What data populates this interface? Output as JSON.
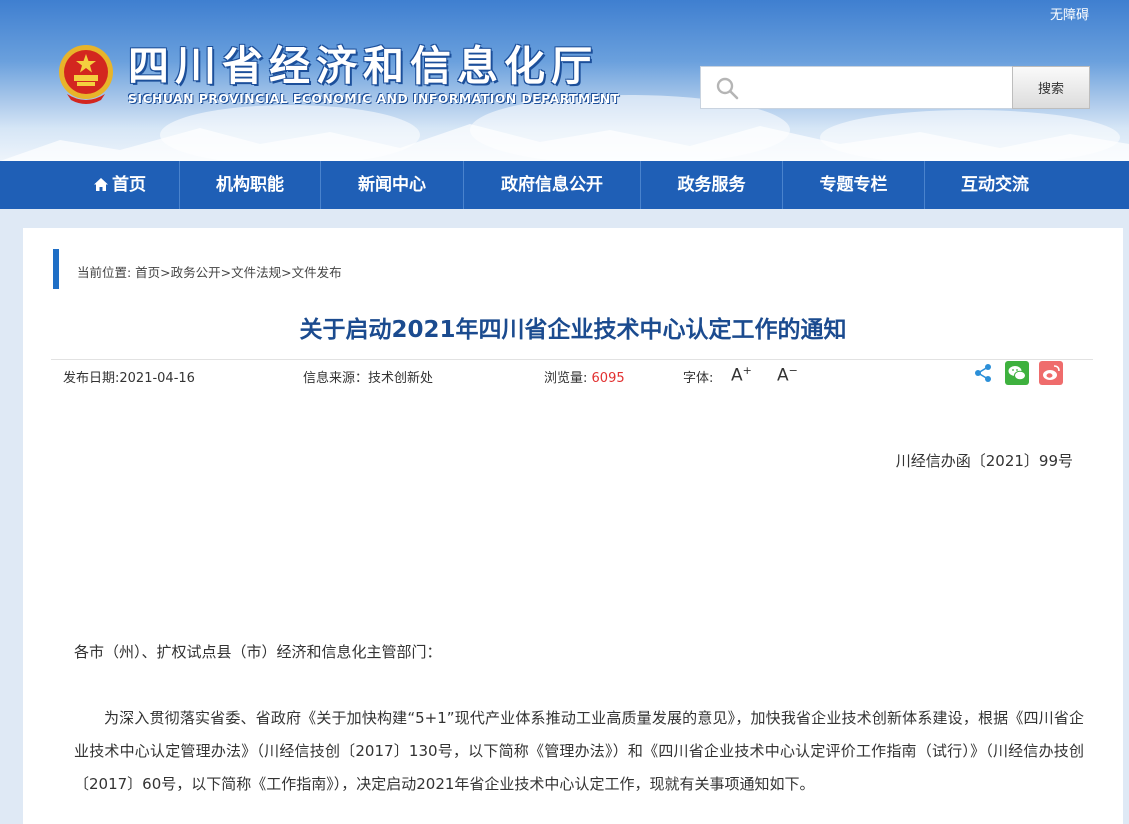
{
  "header": {
    "accessibility_label": "无障碍",
    "site_title_cn": "四川省经济和信息化厅",
    "site_title_en": "SICHUAN PROVINCIAL ECONOMIC AND INFORMATION DEPARTMENT",
    "search_placeholder": "",
    "search_button": "搜索"
  },
  "nav": {
    "items": [
      "首页",
      "机构职能",
      "新闻中心",
      "政府信息公开",
      "政务服务",
      "专题专栏",
      "互动交流"
    ]
  },
  "breadcrumb": "当前位置: 首页>政务公开>文件法规>文件发布",
  "article": {
    "title": "关于启动2021年四川省企业技术中心认定工作的通知",
    "publish_date_label": "发布日期:2021-04-16",
    "source_label": "信息来源：技术创新处",
    "views_label": "浏览量:",
    "views_value": "6095",
    "font_label": "字体:",
    "font_increase": "A",
    "font_decrease": "A",
    "doc_number": "川经信办函〔2021〕99号",
    "addressee": "各市（州）、扩权试点县（市）经济和信息化主管部门：",
    "paragraph": "为深入贯彻落实省委、省政府《关于加快构建“5+1”现代产业体系推动工业高质量发展的意见》，加快我省企业技术创新体系建设，根据《四川省企业技术中心认定管理办法》（川经信技创〔2017〕130号，以下简称《管理办法》）和《四川省企业技术中心认定评价工作指南（试行）》（川经信办技创〔2017〕60号，以下简称《工作指南》），决定启动2021年省企业技术中心认定工作，现就有关事项通知如下。"
  },
  "colors": {
    "nav_blue": "#1f5fb6",
    "title_blue": "#1b4b8f",
    "views_red": "#e23030",
    "wechat_green": "#3eb13e",
    "weibo_red": "#ef6c6c"
  },
  "icons": [
    "national-emblem-icon",
    "search-icon",
    "home-icon",
    "share-icon",
    "wechat-icon",
    "weibo-icon"
  ]
}
